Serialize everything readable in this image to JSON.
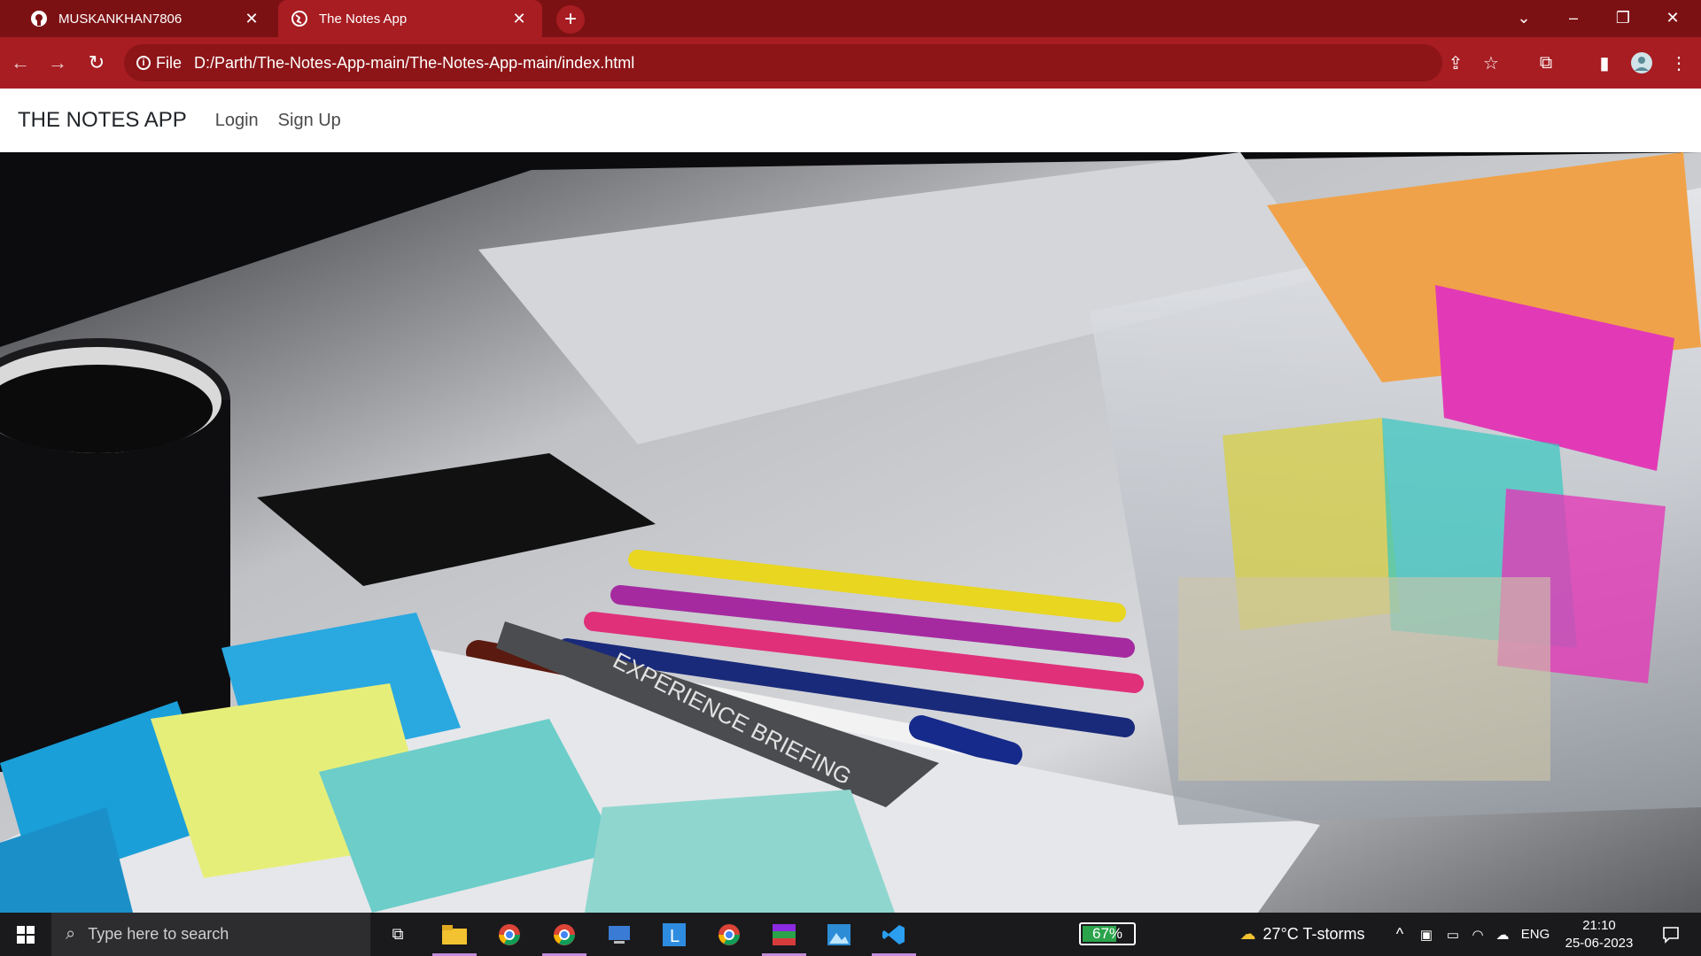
{
  "browser": {
    "tabs": [
      {
        "title": "MUSKANKHAN7806",
        "icon": "github-icon"
      },
      {
        "title": "The Notes App",
        "icon": "globe-icon"
      }
    ],
    "address": {
      "info_label": "File",
      "url": "D:/Parth/The-Notes-App-main/The-Notes-App-main/index.html"
    }
  },
  "page": {
    "brand": "THE NOTES APP",
    "nav": [
      "Login",
      "Sign Up"
    ],
    "hero": {
      "description_colors": {
        "mug": "#0d0d0f",
        "note_blue": "#1b9fd8",
        "note_yellow": "#e6ee7a",
        "note_teal": "#6ccdc9",
        "label_text": "EXPERIENCE BRIEFING"
      }
    }
  },
  "taskbar": {
    "search_placeholder": "Type here to search",
    "battery": "67%",
    "battery_level": 0.67,
    "weather": "27°C  T-storms",
    "language": "ENG",
    "time": "21:10",
    "date": "25-06-2023"
  },
  "colors": {
    "tabstrip": "#7c1114",
    "toolbar": "#a71d22",
    "taskbar": "#1a1a1c"
  }
}
